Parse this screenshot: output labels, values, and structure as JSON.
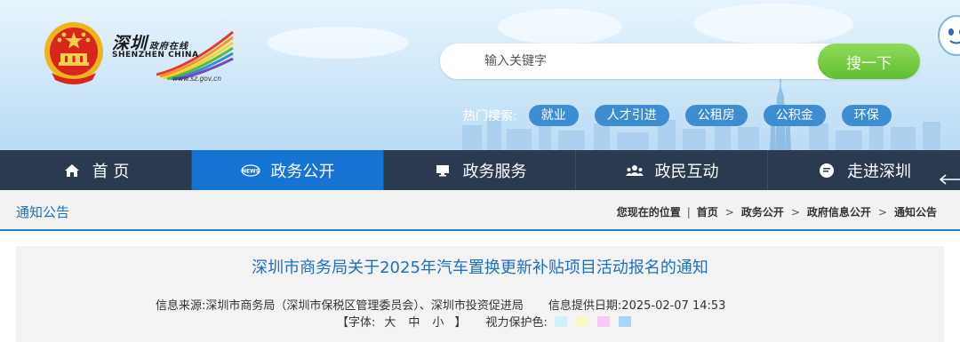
{
  "header": {
    "logo_cn": "深圳",
    "logo_cn_small": "政府在线",
    "logo_en": "SHENZHEN CHINA",
    "logo_url": "www.sz.gov.cn"
  },
  "search": {
    "placeholder": "输入关键字",
    "button_label": "搜一下"
  },
  "hot_search": {
    "label": "热门搜索:",
    "tags": [
      "就业",
      "人才引进",
      "公租房",
      "公积金",
      "环保"
    ]
  },
  "nav": {
    "items": [
      {
        "label": "首 页",
        "icon": "home-icon"
      },
      {
        "label": "政务公开",
        "icon": "news-icon",
        "active": true
      },
      {
        "label": "政务服务",
        "icon": "monitor-icon"
      },
      {
        "label": "政民互动",
        "icon": "people-icon"
      },
      {
        "label": "走进深圳",
        "icon": "chat-icon"
      }
    ]
  },
  "breadcrumb": {
    "section_title": "通知公告",
    "location_label": "您现在的位置",
    "items": [
      "首页",
      "政务公开",
      "政府信息公开",
      "通知公告"
    ],
    "separator": ">"
  },
  "article": {
    "title": "深圳市商务局关于2025年汽车置换更新补贴项目活动报名的通知",
    "source_label": "信息来源:",
    "source_value": "深圳市商务局（深圳市保税区管理委员会）、深圳市投资促进局",
    "date_label": "信息提供日期:",
    "date_value": "2025-02-07 14:53",
    "font_label": "【字体:",
    "font_sizes": [
      "大",
      "中",
      "小"
    ],
    "font_close": "】",
    "eye_label": "视力保护色:",
    "eye_colors": [
      "#ccf3f8",
      "#f7f6c6",
      "#f9c8f3",
      "#a9d4f7"
    ]
  },
  "colors": {
    "nav_bg": "#2b3a4e",
    "nav_active": "#1473d3",
    "accent_blue": "#1f6fbf",
    "search_green": "#5fbf2e"
  }
}
